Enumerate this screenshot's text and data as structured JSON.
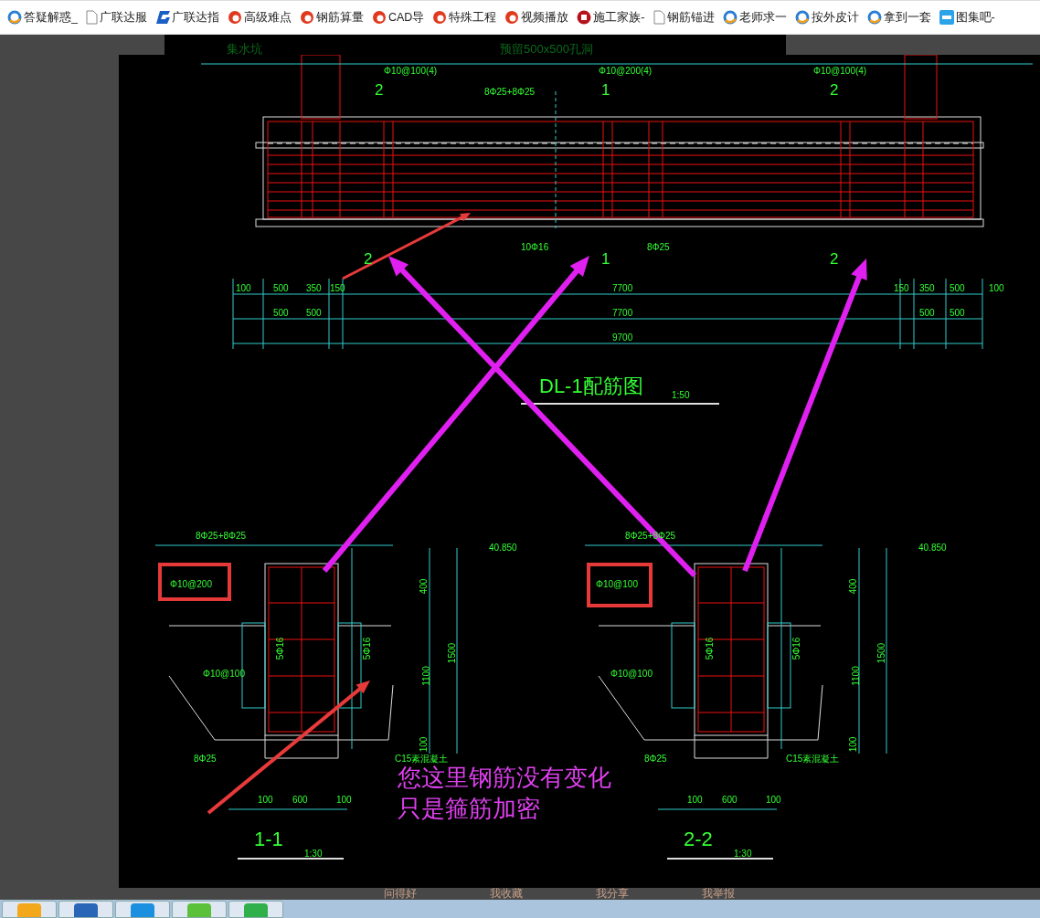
{
  "bookmarks": [
    {
      "label": "答疑解惑_"
    },
    {
      "label": "广联达服"
    },
    {
      "label": "广联达指"
    },
    {
      "label": "高级难点"
    },
    {
      "label": "钢筋算量"
    },
    {
      "label": "CAD导"
    },
    {
      "label": "特殊工程"
    },
    {
      "label": "视频播放"
    },
    {
      "label": "施工家族-"
    },
    {
      "label": "钢筋锚进"
    },
    {
      "label": "老师求一"
    },
    {
      "label": "按外皮计"
    },
    {
      "label": "拿到一套"
    },
    {
      "label": "图集吧-"
    }
  ],
  "upper_image": {
    "labels": [
      "集水坑",
      "预留500x500孔洞"
    ]
  },
  "drawing": {
    "labels": [
      {
        "text": "Φ10@100(4)",
        "kind": "dim"
      },
      {
        "text": "Φ10@200(4)",
        "kind": "dim"
      },
      {
        "text": "Φ10@100(4)",
        "kind": "dim"
      },
      {
        "text": "2",
        "kind": "mark"
      },
      {
        "text": "8Φ25+8Φ25",
        "kind": "dim"
      },
      {
        "text": "1",
        "kind": "mark"
      },
      {
        "text": "2",
        "kind": "mark"
      },
      {
        "text": "10Φ16",
        "kind": "dim"
      },
      {
        "text": "8Φ25",
        "kind": "dim"
      },
      {
        "text": "2",
        "kind": "mark"
      },
      {
        "text": "1",
        "kind": "mark"
      },
      {
        "text": "2",
        "kind": "mark"
      },
      {
        "text": "100",
        "kind": "dim"
      },
      {
        "text": "500",
        "kind": "dim"
      },
      {
        "text": "350",
        "kind": "dim"
      },
      {
        "text": "150",
        "kind": "dim"
      },
      {
        "text": "7700",
        "kind": "dim"
      },
      {
        "text": "150",
        "kind": "dim"
      },
      {
        "text": "350",
        "kind": "dim"
      },
      {
        "text": "500",
        "kind": "dim"
      },
      {
        "text": "100",
        "kind": "dim"
      },
      {
        "text": "500",
        "kind": "dim"
      },
      {
        "text": "500",
        "kind": "dim"
      },
      {
        "text": "7700",
        "kind": "dim"
      },
      {
        "text": "500",
        "kind": "dim"
      },
      {
        "text": "500",
        "kind": "dim"
      },
      {
        "text": "9700",
        "kind": "dim"
      },
      {
        "text": "DL-1配筋图",
        "kind": "title"
      },
      {
        "text": "1:50",
        "kind": "dim"
      },
      {
        "text": "8Φ25+8Φ25",
        "kind": "dim"
      },
      {
        "text": "40.850",
        "kind": "dim"
      },
      {
        "text": "Φ10@200",
        "kind": "dim"
      },
      {
        "text": "400",
        "kind": "vdim"
      },
      {
        "text": "5Φ16",
        "kind": "vdim"
      },
      {
        "text": "5Φ16",
        "kind": "vdim"
      },
      {
        "text": "Φ10@100",
        "kind": "dim"
      },
      {
        "text": "1100",
        "kind": "vdim"
      },
      {
        "text": "1500",
        "kind": "vdim"
      },
      {
        "text": "100",
        "kind": "vdim"
      },
      {
        "text": "8Φ25",
        "kind": "dim"
      },
      {
        "text": "C15素混凝土",
        "kind": "dim"
      },
      {
        "text": "100",
        "kind": "dim"
      },
      {
        "text": "600",
        "kind": "dim"
      },
      {
        "text": "100",
        "kind": "dim"
      },
      {
        "text": "1-1",
        "kind": "title"
      },
      {
        "text": "1:30",
        "kind": "dim"
      },
      {
        "text": "8Φ25+8Φ25",
        "kind": "dim"
      },
      {
        "text": "40.850",
        "kind": "dim"
      },
      {
        "text": "Φ10@100",
        "kind": "dim"
      },
      {
        "text": "400",
        "kind": "vdim"
      },
      {
        "text": "5Φ16",
        "kind": "vdim"
      },
      {
        "text": "5Φ16",
        "kind": "vdim"
      },
      {
        "text": "Φ10@100",
        "kind": "dim"
      },
      {
        "text": "1100",
        "kind": "vdim"
      },
      {
        "text": "1500",
        "kind": "vdim"
      },
      {
        "text": "100",
        "kind": "vdim"
      },
      {
        "text": "8Φ25",
        "kind": "dim"
      },
      {
        "text": "C15素混凝土",
        "kind": "dim"
      },
      {
        "text": "100",
        "kind": "dim"
      },
      {
        "text": "600",
        "kind": "dim"
      },
      {
        "text": "100",
        "kind": "dim"
      },
      {
        "text": "2-2",
        "kind": "title"
      },
      {
        "text": "1:30",
        "kind": "dim"
      },
      {
        "text": "您这里钢筋没有变化",
        "kind": "note"
      },
      {
        "text": "只是箍筋加密",
        "kind": "note"
      }
    ]
  },
  "page_actions": [
    "问得好",
    "我收藏",
    "我分享",
    "我举报"
  ]
}
